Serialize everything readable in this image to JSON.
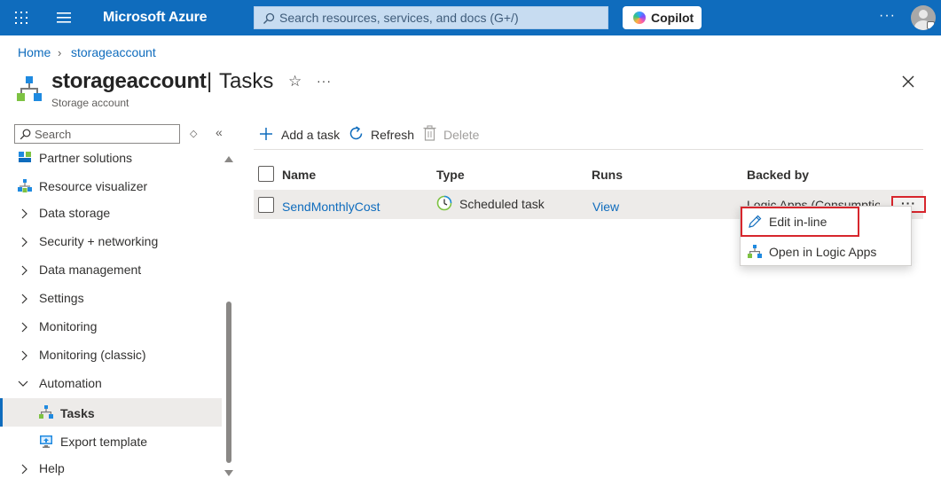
{
  "topbar": {
    "brand": "Microsoft Azure",
    "search_placeholder": "Search resources, services, and docs (G+/)",
    "copilot_label": "Copilot",
    "more_label": "···"
  },
  "breadcrumb": {
    "home": "Home",
    "resource": "storageaccount"
  },
  "header": {
    "resource_name": "storageaccount",
    "separator": "|",
    "page_name": "Tasks",
    "subtitle": "Storage account",
    "star": "☆",
    "more": "···"
  },
  "sidebar": {
    "search_placeholder": "Search",
    "updown": "◇",
    "collapse": "«",
    "items": [
      {
        "label": "Partner solutions",
        "icon": "partner-solutions-icon"
      },
      {
        "label": "Resource visualizer",
        "icon": "resource-visualizer-icon"
      },
      {
        "label": "Data storage",
        "expandable": true
      },
      {
        "label": "Security + networking",
        "expandable": true
      },
      {
        "label": "Data management",
        "expandable": true
      },
      {
        "label": "Settings",
        "expandable": true
      },
      {
        "label": "Monitoring",
        "expandable": true
      },
      {
        "label": "Monitoring (classic)",
        "expandable": true
      },
      {
        "label": "Automation",
        "expandable": true,
        "expanded": true
      },
      {
        "label": "Tasks",
        "icon": "tasks-icon",
        "selected": true
      },
      {
        "label": "Export template",
        "icon": "export-template-icon"
      },
      {
        "label": "Help",
        "expandable": true
      }
    ]
  },
  "toolbar": {
    "add_label": "Add a task",
    "refresh_label": "Refresh",
    "delete_label": "Delete"
  },
  "table": {
    "columns": [
      "Name",
      "Type",
      "Runs",
      "Backed by"
    ],
    "rows": [
      {
        "name": "SendMonthlyCost",
        "type": "Scheduled task",
        "runs": "View",
        "backed_by": "Logic Apps (Consumption)"
      }
    ],
    "row_more": "···"
  },
  "context_menu": {
    "items": [
      {
        "label": "Edit in-line",
        "icon": "pencil-icon"
      },
      {
        "label": "Open in Logic Apps",
        "icon": "logic-apps-icon"
      }
    ]
  },
  "colors": {
    "azure_blue": "#0f6cbd",
    "highlight_red": "#d7262d",
    "selected_bg": "#edebe9"
  }
}
